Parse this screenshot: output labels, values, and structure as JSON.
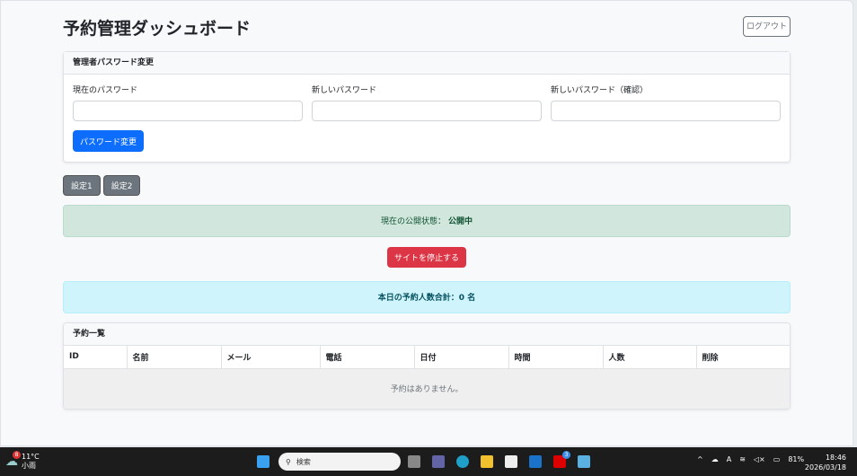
{
  "header": {
    "title": "予約管理ダッシュボード",
    "logout": "ログアウト"
  },
  "password": {
    "title": "管理者パスワード変更",
    "current": "現在のパスワード",
    "new": "新しいパスワード",
    "confirm": "新しいパスワード（確認）",
    "submit": "パスワード変更"
  },
  "settings": [
    "設定1",
    "設定2"
  ],
  "status": {
    "label": "現在の公開状態：",
    "value": "公開中",
    "stop": "サイトを停止する"
  },
  "today": "本日の予約人数合計：0 名",
  "list": {
    "title": "予約一覧",
    "columns": [
      "ID",
      "名前",
      "メール",
      "電話",
      "日付",
      "時間",
      "人数",
      "削除"
    ],
    "empty": "予約はありません。"
  },
  "taskbar": {
    "weather_temp": "11°C",
    "weather_desc": "小雨",
    "weather_badge": "8",
    "search": "検索",
    "mail_badge": "3",
    "battery": "81%",
    "time": "18:46",
    "date": "2026/03/18",
    "ime": "A"
  }
}
